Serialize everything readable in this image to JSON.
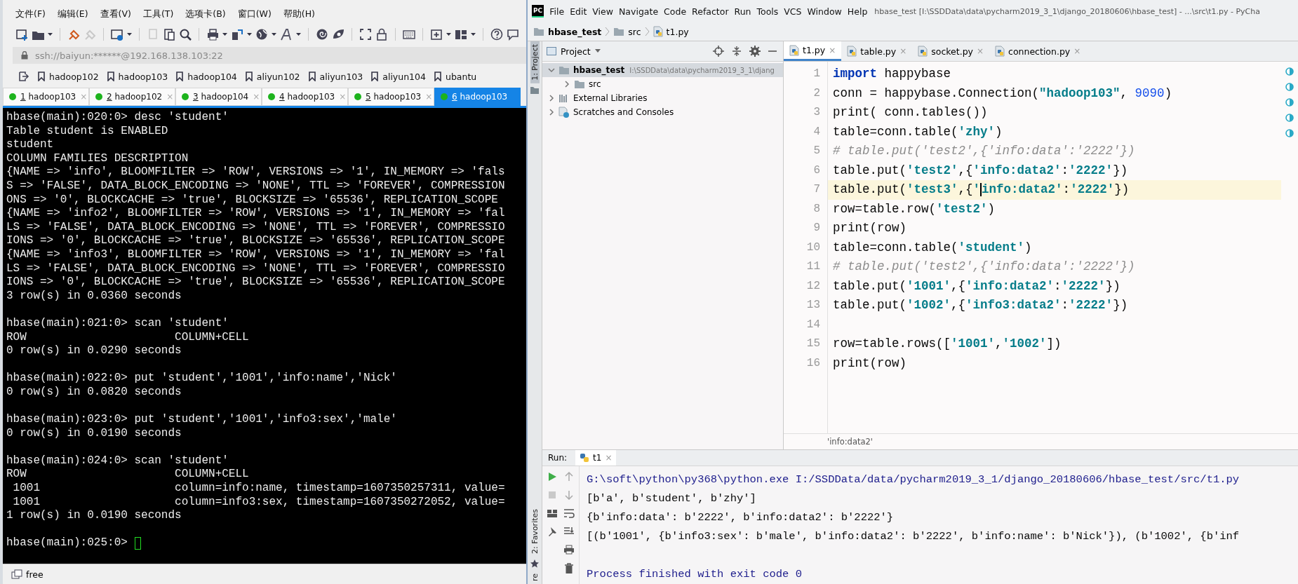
{
  "terminal_app": {
    "menu": [
      "文件(F)",
      "编辑(E)",
      "查看(V)",
      "工具(T)",
      "选项卡(B)",
      "窗口(W)",
      "帮助(H)"
    ],
    "address": "ssh://baiyun:******@192.168.138.103:22",
    "bookmarks": [
      "hadoop102",
      "hadoop103",
      "hadoop104",
      "aliyun102",
      "aliyun103",
      "aliyun104",
      "ubantu"
    ],
    "tabs": [
      {
        "number": "1",
        "label": "hadoop103",
        "connected": true,
        "close": "×",
        "selected": false
      },
      {
        "number": "2",
        "label": "hadoop102",
        "connected": true,
        "close": "×",
        "selected": false
      },
      {
        "number": "3",
        "label": "hadoop104",
        "connected": true,
        "close": "×",
        "selected": false
      },
      {
        "number": "4",
        "label": "hadoop103",
        "connected": true,
        "close": "×",
        "selected": false
      },
      {
        "number": "5",
        "label": "hadoop103",
        "connected": true,
        "close": "×",
        "selected": false
      },
      {
        "number": "6",
        "label": "hadoop103",
        "connected": true,
        "selected": true
      }
    ],
    "session": [
      {
        "input": "hbase(main):020:0> desc 'student'",
        "output": [
          "Table student is ENABLED",
          "student",
          "COLUMN FAMILIES DESCRIPTION",
          "{NAME => 'info', BLOOMFILTER => 'ROW', VERSIONS => '1', IN_MEMORY => 'fals",
          "S => 'FALSE', DATA_BLOCK_ENCODING => 'NONE', TTL => 'FOREVER', COMPRESSION",
          "ONS => '0', BLOCKCACHE => 'true', BLOCKSIZE => '65536', REPLICATION_SCOPE",
          "{NAME => 'info2', BLOOMFILTER => 'ROW', VERSIONS => '1', IN_MEMORY => 'fal",
          "LS => 'FALSE', DATA_BLOCK_ENCODING => 'NONE', TTL => 'FOREVER', COMPRESSIO",
          "IONS => '0', BLOCKCACHE => 'true', BLOCKSIZE => '65536', REPLICATION_SCOPE",
          "{NAME => 'info3', BLOOMFILTER => 'ROW', VERSIONS => '1', IN_MEMORY => 'fal",
          "LS => 'FALSE', DATA_BLOCK_ENCODING => 'NONE', TTL => 'FOREVER', COMPRESSIO",
          "IONS => '0', BLOCKCACHE => 'true', BLOCKSIZE => '65536', REPLICATION_SCOPE",
          "3 row(s) in 0.0360 seconds"
        ]
      },
      {
        "input": "hbase(main):021:0> scan 'student'",
        "output": [
          "ROW                      COLUMN+CELL",
          "0 row(s) in 0.0290 seconds"
        ]
      },
      {
        "input": "hbase(main):022:0> put 'student','1001','info:name','Nick'",
        "output": [
          "0 row(s) in 0.0820 seconds"
        ]
      },
      {
        "input": "hbase(main):023:0> put 'student','1001','info3:sex','male'",
        "output": [
          "0 row(s) in 0.0190 seconds"
        ]
      },
      {
        "input": "hbase(main):024:0> scan 'student'",
        "output": [
          "ROW                      COLUMN+CELL",
          " 1001                    column=info:name, timestamp=1607350257311, value=",
          " 1001                    column=info3:sex, timestamp=1607350272052, value=",
          "1 row(s) in 0.0190 seconds"
        ]
      },
      {
        "input": "hbase(main):025:0>",
        "cursor": true
      }
    ],
    "status_bar": "free"
  },
  "ide": {
    "logo": "PC",
    "menu": [
      "File",
      "Edit",
      "View",
      "Navigate",
      "Code",
      "Refactor",
      "Run",
      "Tools",
      "VCS",
      "Window",
      "Help"
    ],
    "title": "hbase_test [I:\\SSDData\\data\\pycharm2019_3_1\\django_20180606\\hbase_test] - ...\\src\\t1.py - PyCha",
    "breadcrumb": [
      "hbase_test",
      "src",
      "t1.py"
    ],
    "side_tabs": [
      {
        "label": "1: Project",
        "selected": true
      },
      {
        "label": "2: Favorites",
        "selected": false
      },
      {
        "label": "re",
        "selected": false
      }
    ],
    "project": {
      "title": "Project",
      "tree": [
        {
          "label": "hbase_test",
          "path": "I:\\SSDData\\data\\pycharm2019_3_1\\djang",
          "kind": "folder",
          "expanded": true,
          "children": [
            {
              "label": "src",
              "kind": "folder",
              "expanded": false
            }
          ]
        },
        {
          "label": "External Libraries",
          "kind": "library",
          "expanded": false
        },
        {
          "label": "Scratches and Consoles",
          "kind": "scratch",
          "expanded": false
        }
      ]
    },
    "tabs": [
      {
        "label": "t1.py",
        "close": "×",
        "selected": true
      },
      {
        "label": "table.py",
        "close": "×",
        "selected": false
      },
      {
        "label": "socket.py",
        "close": "×",
        "selected": false
      },
      {
        "label": "connection.py",
        "close": "×",
        "selected": false
      }
    ],
    "code": [
      {
        "number": "1",
        "tokens": [
          {
            "kind": "keyword",
            "text": "import"
          },
          {
            "kind": "plain",
            "text": " happybase"
          }
        ]
      },
      {
        "number": "2",
        "tokens": [
          {
            "kind": "plain",
            "text": "conn = happybase.Connection("
          },
          {
            "kind": "string",
            "text": "\"hadoop103\""
          },
          {
            "kind": "plain",
            "text": ", "
          },
          {
            "kind": "number",
            "text": "9090"
          },
          {
            "kind": "plain",
            "text": ")"
          }
        ]
      },
      {
        "number": "3",
        "tokens": [
          {
            "kind": "plain",
            "text": "print( conn.tables())"
          }
        ]
      },
      {
        "number": "4",
        "tokens": [
          {
            "kind": "plain",
            "text": "table=conn.table("
          },
          {
            "kind": "string",
            "text": "'zhy'"
          },
          {
            "kind": "plain",
            "text": ")"
          }
        ]
      },
      {
        "number": "5",
        "tokens": [
          {
            "kind": "comment",
            "text": "# table.put('test2',{'info:data':'2222'})"
          }
        ]
      },
      {
        "number": "6",
        "tokens": [
          {
            "kind": "plain",
            "text": "table.put("
          },
          {
            "kind": "string",
            "text": "'test2'"
          },
          {
            "kind": "plain",
            "text": ",{"
          },
          {
            "kind": "string",
            "text": "'info:data2'"
          },
          {
            "kind": "plain",
            "text": ":"
          },
          {
            "kind": "string",
            "text": "'2222'"
          },
          {
            "kind": "plain",
            "text": "})"
          }
        ]
      },
      {
        "number": "7",
        "current": true,
        "tokens": [
          {
            "kind": "plain",
            "text": "table.put("
          },
          {
            "kind": "string",
            "text": "'test3'"
          },
          {
            "kind": "plain",
            "text": ",{"
          },
          {
            "kind": "string",
            "text": "'"
          },
          {
            "kind": "string",
            "text": "info:data2'",
            "caret": true
          },
          {
            "kind": "plain",
            "text": ":"
          },
          {
            "kind": "string",
            "text": "'2222'"
          },
          {
            "kind": "plain",
            "text": "})"
          }
        ]
      },
      {
        "number": "8",
        "tokens": [
          {
            "kind": "plain",
            "text": "row=table.row("
          },
          {
            "kind": "string",
            "text": "'test2'"
          },
          {
            "kind": "plain",
            "text": ")"
          }
        ]
      },
      {
        "number": "9",
        "tokens": [
          {
            "kind": "plain",
            "text": "print(row)"
          }
        ]
      },
      {
        "number": "10",
        "tokens": [
          {
            "kind": "plain",
            "text": "table=conn.table("
          },
          {
            "kind": "string",
            "text": "'student'"
          },
          {
            "kind": "plain",
            "text": ")"
          }
        ]
      },
      {
        "number": "11",
        "tokens": [
          {
            "kind": "comment",
            "text": "# table.put('test2',{'info:data':'2222'})"
          }
        ]
      },
      {
        "number": "12",
        "tokens": [
          {
            "kind": "plain",
            "text": "table.put("
          },
          {
            "kind": "string",
            "text": "'1001'"
          },
          {
            "kind": "plain",
            "text": ",{"
          },
          {
            "kind": "string",
            "text": "'info:data2'"
          },
          {
            "kind": "plain",
            "text": ":"
          },
          {
            "kind": "string",
            "text": "'2222'"
          },
          {
            "kind": "plain",
            "text": "})"
          }
        ]
      },
      {
        "number": "13",
        "tokens": [
          {
            "kind": "plain",
            "text": "table.put("
          },
          {
            "kind": "string",
            "text": "'1002'"
          },
          {
            "kind": "plain",
            "text": ",{"
          },
          {
            "kind": "string",
            "text": "'info3:data2'"
          },
          {
            "kind": "plain",
            "text": ":"
          },
          {
            "kind": "string",
            "text": "'2222'"
          },
          {
            "kind": "plain",
            "text": "})"
          }
        ]
      },
      {
        "number": "14"
      },
      {
        "number": "15",
        "tokens": [
          {
            "kind": "plain",
            "text": "row=table.rows(["
          },
          {
            "kind": "string",
            "text": "'1001'"
          },
          {
            "kind": "plain",
            "text": ","
          },
          {
            "kind": "string",
            "text": "'1002'"
          },
          {
            "kind": "plain",
            "text": "])"
          }
        ]
      },
      {
        "number": "16",
        "tokens": [
          {
            "kind": "plain",
            "text": "print(row)"
          }
        ]
      }
    ],
    "hint": "'info:data2'",
    "run": {
      "label": "Run:",
      "tab": {
        "label": "t1",
        "close": "×"
      },
      "output": [
        {
          "kind": "command",
          "text": "G:\\soft\\python\\py368\\python.exe I:/SSDData/data/pycharm2019_3_1/django_20180606/hbase_test/src/t1.py"
        },
        {
          "kind": "stdout",
          "text": "[b'a', b'student', b'zhy']"
        },
        {
          "kind": "stdout",
          "text": "{b'info:data': b'2222', b'info:data2': b'2222'}"
        },
        {
          "kind": "stdout",
          "text": "[(b'1001', {b'info3:sex': b'male', b'info:data2': b'2222', b'info:name': b'Nick'}), (b'1002', {b'inf"
        },
        {
          "kind": "system",
          "text": "Process finished with exit code 0",
          "gap_before": true
        }
      ]
    }
  }
}
